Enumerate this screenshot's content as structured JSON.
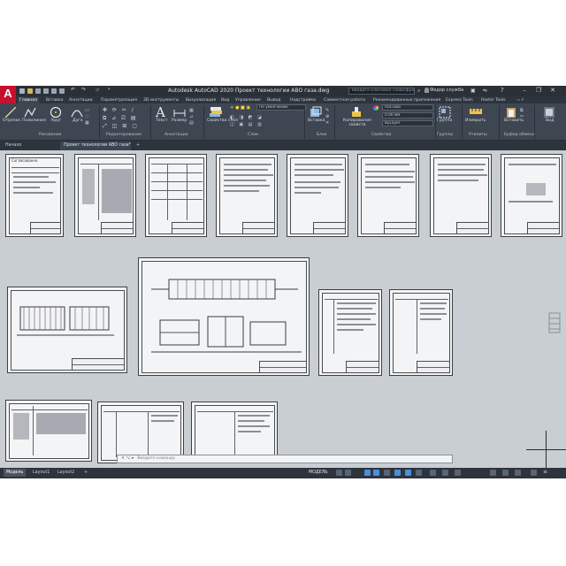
{
  "window": {
    "title": "Autodesk AutoCAD 2020  Проект технологии АВО газа.dwg",
    "search_placeholder": "Введите ключевое слово/фразу",
    "user": "Федор служба"
  },
  "ribbon_tabs": [
    "Главная",
    "Вставка",
    "Аннотации",
    "Параметризация",
    "3D инструменты",
    "Визуализация",
    "Вид",
    "Управление",
    "Вывод",
    "Надстройки",
    "Совместная работа",
    "Рекомендованные приложения",
    "Express Tools",
    "Raster Tools"
  ],
  "ribbon": {
    "draw_tools": [
      "Отрезок",
      "Полилиния",
      "Круг",
      "Дуга"
    ],
    "annotation_tools": [
      "Текст",
      "Размер"
    ],
    "layer_properties_label": "Свойства слоя",
    "layer_combo": "По умолчанию",
    "insert_label": "Вставка",
    "match_properties_label": "Копирование свойств",
    "color_combo": "ПоСлою",
    "lineweight_combo": "0.00 мм",
    "linetype_combo": "ByLayer",
    "group_label": "Группа",
    "measure_label": "Измерить",
    "paste_label": "Вставить",
    "view_label": "Вид",
    "panels": [
      "Рисование",
      "Редактирование",
      "Аннотации",
      "Слои",
      "Блок",
      "Свойства",
      "Группы",
      "Утилиты",
      "Буфер обмена"
    ]
  },
  "file_tabs": {
    "start": "Начало",
    "active": "Проект технологии АВО газа*",
    "add": "+"
  },
  "drawing": {
    "first_sheet_heading": "Согласованно",
    "cmd_placeholder": "Введите команду"
  },
  "layout_tabs": [
    "Модель",
    "Layout1",
    "Layout2",
    "+"
  ],
  "status": {
    "model_label": "МОДЕЛЬ"
  },
  "colors": {
    "accent": "#c8102e",
    "canvas": "#c8ced2",
    "ui_dark": "#3e4652"
  }
}
